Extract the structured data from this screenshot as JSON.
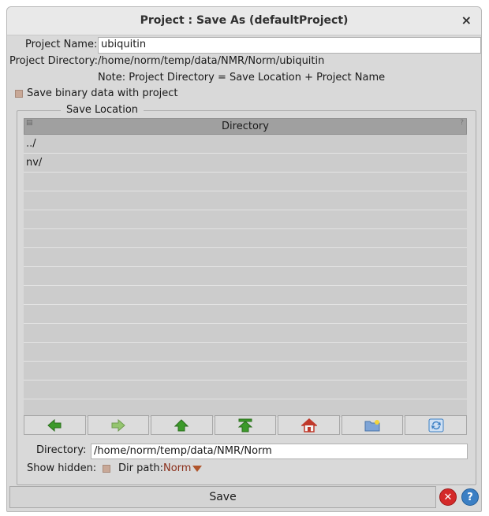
{
  "window": {
    "title": "Project : Save As (defaultProject)",
    "close_glyph": "×"
  },
  "project": {
    "name_label": "Project Name:",
    "name_value": "ubiquitin",
    "dir_label": "Project Directory:",
    "dir_value": "/home/norm/temp/data/NMR/Norm/ubiquitin",
    "note": "Note: Project Directory = Save Location + Project Name"
  },
  "binary": {
    "label": "Save binary data with project",
    "checked": false
  },
  "save_location": {
    "legend": "Save Location",
    "table": {
      "header": "Directory",
      "rows": [
        "../",
        "nv/",
        "",
        "",
        "",
        "",
        "",
        "",
        "",
        "",
        "",
        "",
        "",
        "",
        ""
      ]
    },
    "nav": [
      {
        "name": "back-arrow-icon",
        "color": "#3c9a2a"
      },
      {
        "name": "forward-arrow-icon",
        "color": "#94c56e"
      },
      {
        "name": "up-arrow-icon",
        "color": "#3c9a2a"
      },
      {
        "name": "top-arrow-icon",
        "color": "#3c9a2a"
      },
      {
        "name": "home-icon",
        "color": "#c0392b"
      },
      {
        "name": "new-folder-icon",
        "color": "#5a86c2"
      },
      {
        "name": "refresh-icon",
        "color": "#3b7fc4"
      }
    ],
    "directory_label": "Directory:",
    "directory_value": "/home/norm/temp/data/NMR/Norm",
    "show_hidden_label": "Show hidden:",
    "dir_path_label": "Dir path:",
    "dir_path_value": "Norm"
  },
  "footer": {
    "save_label": "Save",
    "cancel_glyph": "✕",
    "help_glyph": "?"
  },
  "colors": {
    "cancel": "#d42a2a",
    "help": "#3b7fc4"
  }
}
